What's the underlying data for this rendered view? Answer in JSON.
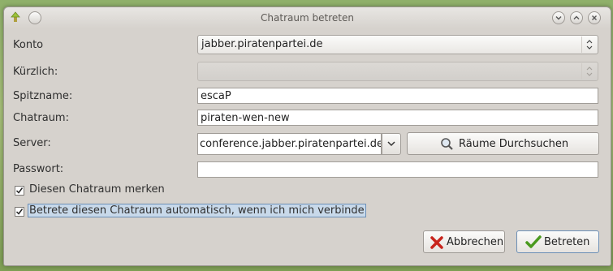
{
  "window": {
    "title": "Chatraum betreten"
  },
  "fields": {
    "account": {
      "label": "Konto",
      "value": "jabber.piratenpartei.de"
    },
    "recent": {
      "label": "Kürzlich:",
      "value": ""
    },
    "nickname": {
      "label": "Spitzname:",
      "value": "escaP"
    },
    "room": {
      "label": "Chatraum:",
      "value": "piraten-wen-new"
    },
    "server": {
      "label": "Server:",
      "value": "conference.jabber.piratenpartei.de",
      "browse_label": "Räume Durchsuchen"
    },
    "password": {
      "label": "Passwort:",
      "value": ""
    }
  },
  "checkboxes": {
    "remember": {
      "label": "Diesen Chatraum merken",
      "checked": true
    },
    "autojoin": {
      "label": "Betrete diesen Chatraum automatisch, wenn ich mich verbinde",
      "checked": true
    }
  },
  "buttons": {
    "cancel": "Abbrechen",
    "join": "Betreten"
  }
}
